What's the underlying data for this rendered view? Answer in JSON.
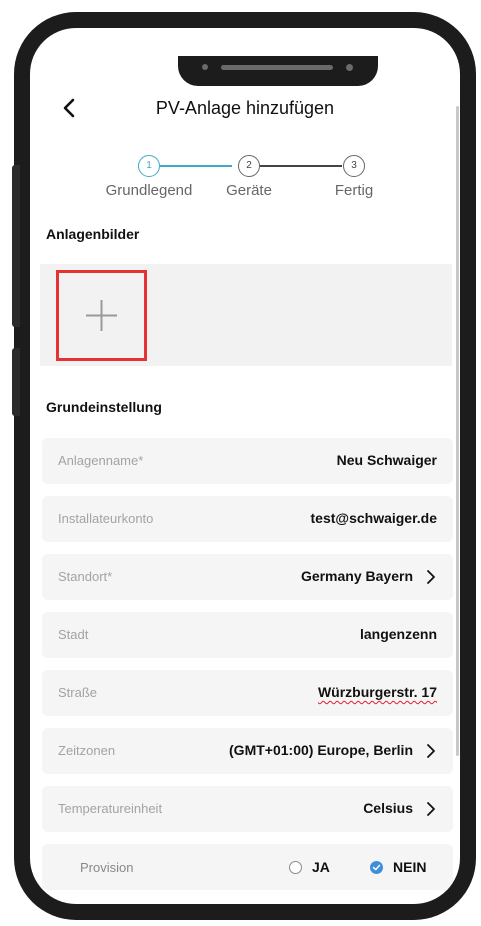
{
  "header": {
    "title": "PV-Anlage hinzufügen",
    "back_icon": "chevron-left-icon"
  },
  "steps": [
    {
      "number": "1",
      "label": "Grundlegend",
      "active": true
    },
    {
      "number": "2",
      "label": "Geräte",
      "active": false
    },
    {
      "number": "3",
      "label": "Fertig",
      "active": false
    }
  ],
  "colors": {
    "accent": "#3fa9c8",
    "highlight_border": "#e53232",
    "checked_radio": "#3f8fd8"
  },
  "images_section": {
    "title": "Anlagenbilder",
    "add_icon": "plus-icon"
  },
  "settings_section": {
    "title": "Grundeinstellung",
    "rows": [
      {
        "label": "Anlagenname*",
        "value": "Neu Schwaiger"
      },
      {
        "label": "Installateurkonto",
        "value": "test@schwaiger.de"
      },
      {
        "label": "Standort*",
        "value": "Germany Bayern"
      },
      {
        "label": "Stadt",
        "value": "langenzenn"
      },
      {
        "label": "Straße",
        "value": "Würzburgerstr. 17"
      },
      {
        "label": "Zeitzonen",
        "value": "(GMT+01:00) Europe, Berlin"
      },
      {
        "label": "Temperatureinheit",
        "value": "Celsius"
      }
    ],
    "provision": {
      "label": "Provision",
      "options": [
        "JA",
        "NEIN"
      ],
      "selected": "NEIN"
    }
  }
}
